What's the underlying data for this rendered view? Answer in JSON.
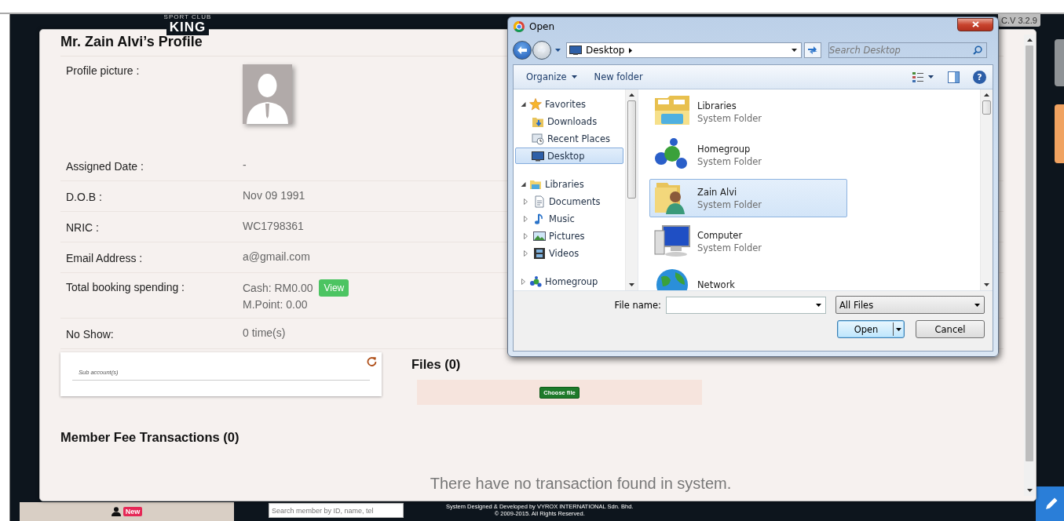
{
  "header": {
    "logo_top": "SPORT CLUB",
    "logo": "KING",
    "version": "C.V 3.2.9"
  },
  "profile": {
    "title": "Mr. Zain Alvi’s Profile",
    "fields": [
      {
        "kind": "photo",
        "label": "Profile picture :"
      },
      {
        "kind": "text",
        "label": "Assigned Date :",
        "value": "-"
      },
      {
        "kind": "text",
        "label": "D.O.B :",
        "value": "Nov 09 1991"
      },
      {
        "kind": "text",
        "label": "NRIC :",
        "value": "WC1798361"
      },
      {
        "kind": "text",
        "label": "Email Address :",
        "value": "a@gmail.com"
      },
      {
        "kind": "spending",
        "label": "Total booking spending :",
        "lines": [
          "Cash: RM0.00",
          "M.Point: 0.00"
        ],
        "button": "View"
      },
      {
        "kind": "text",
        "label": "No Show:",
        "value": "0 time(s)"
      }
    ],
    "sub_accounts": {
      "label": "Sub account(s)"
    },
    "files": {
      "title": "Files (0)",
      "button": "Choose file"
    },
    "transactions": {
      "title": "Member Fee Transactions (0)",
      "empty": "There have no transaction found in system."
    }
  },
  "footer": {
    "badge": "New",
    "search": {
      "placeholder": "Search member by ID, name, tel"
    },
    "credits": [
      "System Designed & Developed by VYROX INTERNATIONAL Sdn. Bhd.",
      "© 2009-2015. All Rights Reserved."
    ]
  },
  "dialog": {
    "title": "Open",
    "address": "Desktop",
    "search": {
      "placeholder": "Search Desktop"
    },
    "toolbar": [
      {
        "label": "Organize",
        "menu": true
      },
      {
        "label": "New folder",
        "menu": false
      }
    ],
    "nav": [
      {
        "label": "Favorites",
        "expanded": true,
        "selected": false,
        "children": [
          {
            "label": "Downloads",
            "selected": false
          },
          {
            "label": "Recent Places",
            "selected": false
          },
          {
            "label": "Desktop",
            "selected": true
          }
        ]
      },
      {
        "label": "Libraries",
        "expanded": true,
        "selected": false,
        "children": [
          {
            "label": "Documents",
            "expanded": false,
            "selected": false
          },
          {
            "label": "Music",
            "expanded": false,
            "selected": false
          },
          {
            "label": "Pictures",
            "expanded": false,
            "selected": false
          },
          {
            "label": "Videos",
            "expanded": false,
            "selected": false
          }
        ]
      },
      {
        "label": "Homegroup",
        "expanded": false,
        "selected": false
      }
    ],
    "items": [
      {
        "name": "Libraries",
        "type": "System Folder",
        "selected": false
      },
      {
        "name": "Homegroup",
        "type": "System Folder",
        "selected": false
      },
      {
        "name": "Zain Alvi",
        "type": "System Folder",
        "selected": true
      },
      {
        "name": "Computer",
        "type": "System Folder",
        "selected": false
      },
      {
        "name": "Network",
        "selected": false
      }
    ],
    "help": "?",
    "file_name": {
      "label": "File name:"
    },
    "file_type": "All Files",
    "buttons": [
      {
        "label": "Open",
        "split": true
      },
      {
        "label": "Cancel",
        "split": false
      }
    ]
  }
}
